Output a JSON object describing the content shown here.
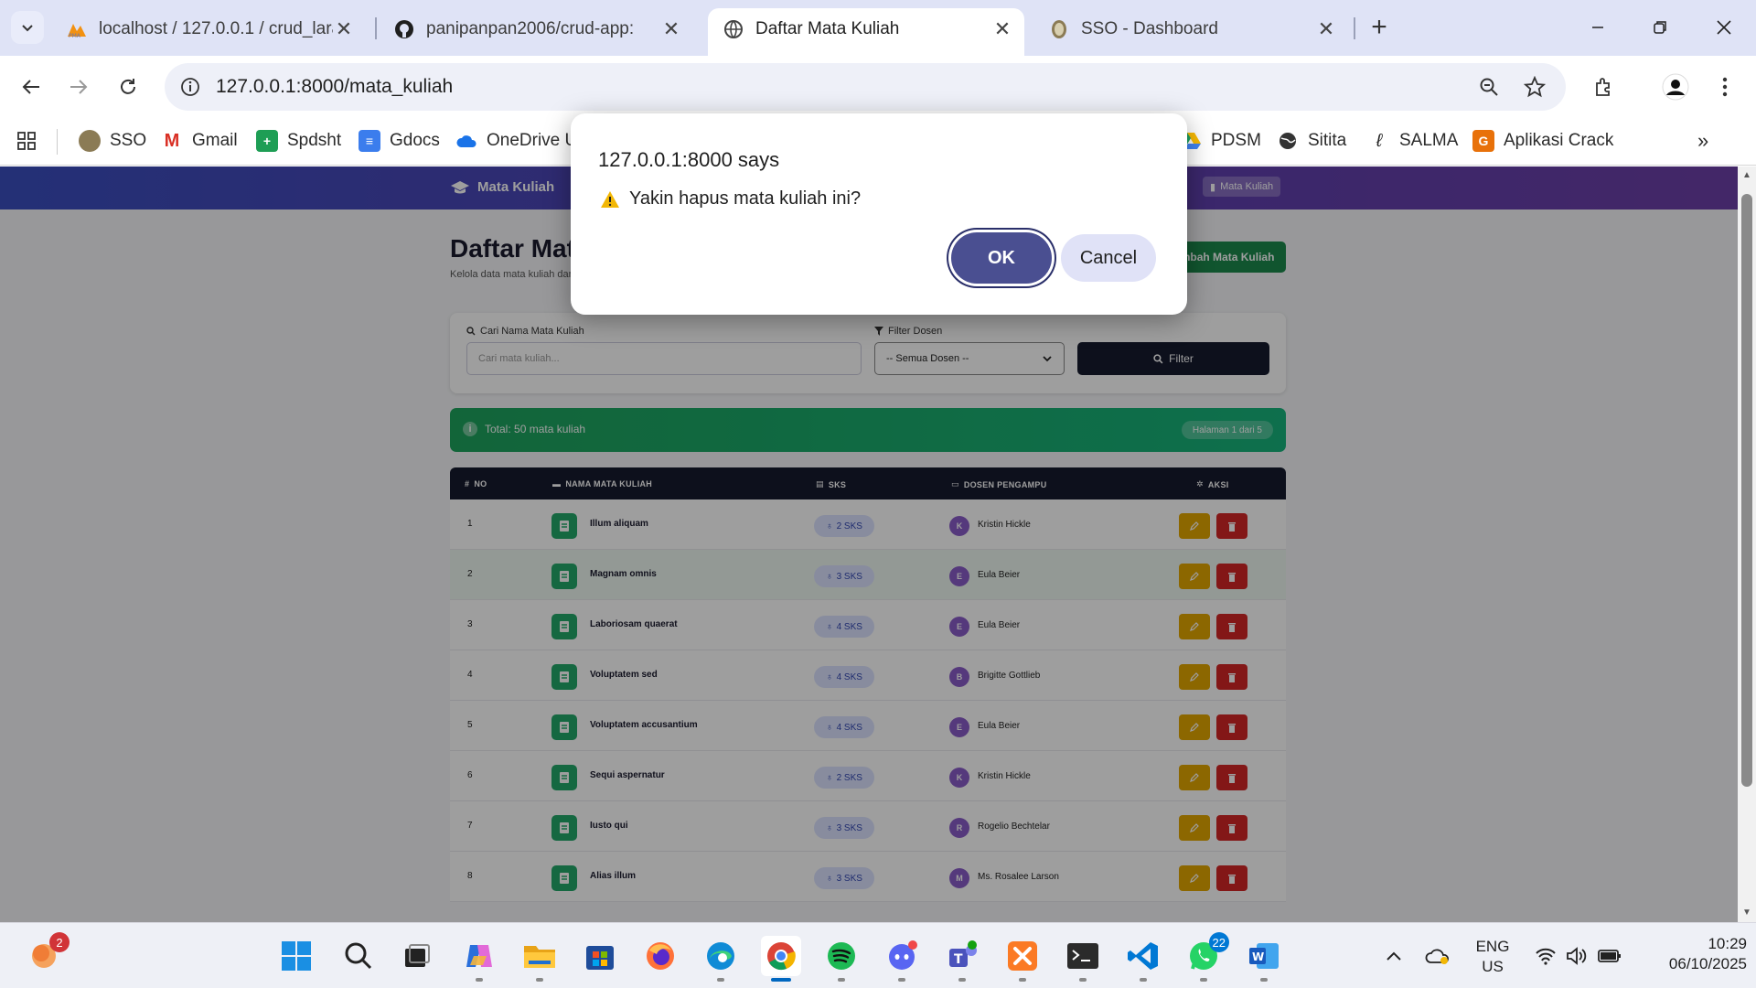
{
  "browser": {
    "tabs": [
      {
        "title": "localhost / 127.0.0.1 / crud_lara",
        "active": false
      },
      {
        "title": "panipanpan2006/crud-app:",
        "active": false
      },
      {
        "title": "Daftar Mata Kuliah",
        "active": true
      },
      {
        "title": "SSO - Dashboard",
        "active": false
      }
    ],
    "url": "127.0.0.1:8000/mata_kuliah",
    "bookmarks": [
      "SSO",
      "Gmail",
      "Spdsht",
      "Gdocs",
      "OneDrive U",
      "PDSM",
      "Sitita",
      "SALMA",
      "Aplikasi Crack"
    ]
  },
  "page": {
    "nav_brand": "Mata Kuliah",
    "nav_pill": "Mata Kuliah",
    "title": "Daftar Mata Kuliah",
    "subtitle": "Kelola data mata kuliah dan dosen pengampu",
    "add_button": "Tambah Mata Kuliah",
    "filter": {
      "search_label": "Cari Nama Mata Kuliah",
      "search_placeholder": "Cari mata kuliah...",
      "dosen_label": "Filter Dosen",
      "dosen_selected": "-- Semua Dosen --",
      "button": "Filter"
    },
    "total_text": "Total: 50 mata kuliah",
    "page_info": "Halaman 1 dari 5",
    "table": {
      "headers": [
        "NO",
        "NAMA MATA KULIAH",
        "SKS",
        "DOSEN PENGAMPU",
        "AKSI"
      ],
      "rows": [
        {
          "no": "1",
          "nama": "Illum aliquam",
          "sks": "2 SKS",
          "initial": "K",
          "dosen": "Kristin Hickle"
        },
        {
          "no": "2",
          "nama": "Magnam omnis",
          "sks": "3 SKS",
          "initial": "E",
          "dosen": "Eula Beier"
        },
        {
          "no": "3",
          "nama": "Laboriosam quaerat",
          "sks": "4 SKS",
          "initial": "E",
          "dosen": "Eula Beier"
        },
        {
          "no": "4",
          "nama": "Voluptatem sed",
          "sks": "4 SKS",
          "initial": "B",
          "dosen": "Brigitte Gottlieb"
        },
        {
          "no": "5",
          "nama": "Voluptatem accusantium",
          "sks": "4 SKS",
          "initial": "E",
          "dosen": "Eula Beier"
        },
        {
          "no": "6",
          "nama": "Sequi aspernatur",
          "sks": "2 SKS",
          "initial": "K",
          "dosen": "Kristin Hickle"
        },
        {
          "no": "7",
          "nama": "Iusto qui",
          "sks": "3 SKS",
          "initial": "R",
          "dosen": "Rogelio Bechtelar"
        },
        {
          "no": "8",
          "nama": "Alias illum",
          "sks": "3 SKS",
          "initial": "M",
          "dosen": "Ms. Rosalee Larson"
        }
      ]
    }
  },
  "dialog": {
    "title": "127.0.0.1:8000 says",
    "message": "Yakin hapus mata kuliah ini?",
    "ok": "OK",
    "cancel": "Cancel"
  },
  "taskbar": {
    "start_badge": "2",
    "whatsapp_badge": "22",
    "lang_1": "ENG",
    "lang_2": "US",
    "time": "10:29",
    "date": "06/10/2025"
  },
  "colors": {
    "nav_gradient_start": "#3a4ebf",
    "nav_gradient_end": "#6d3fa8",
    "success": "#1ea35d",
    "edit": "#e3a600",
    "delete": "#d42626",
    "table_header": "#161a2e",
    "dialog_ok": "#4a4f91"
  }
}
